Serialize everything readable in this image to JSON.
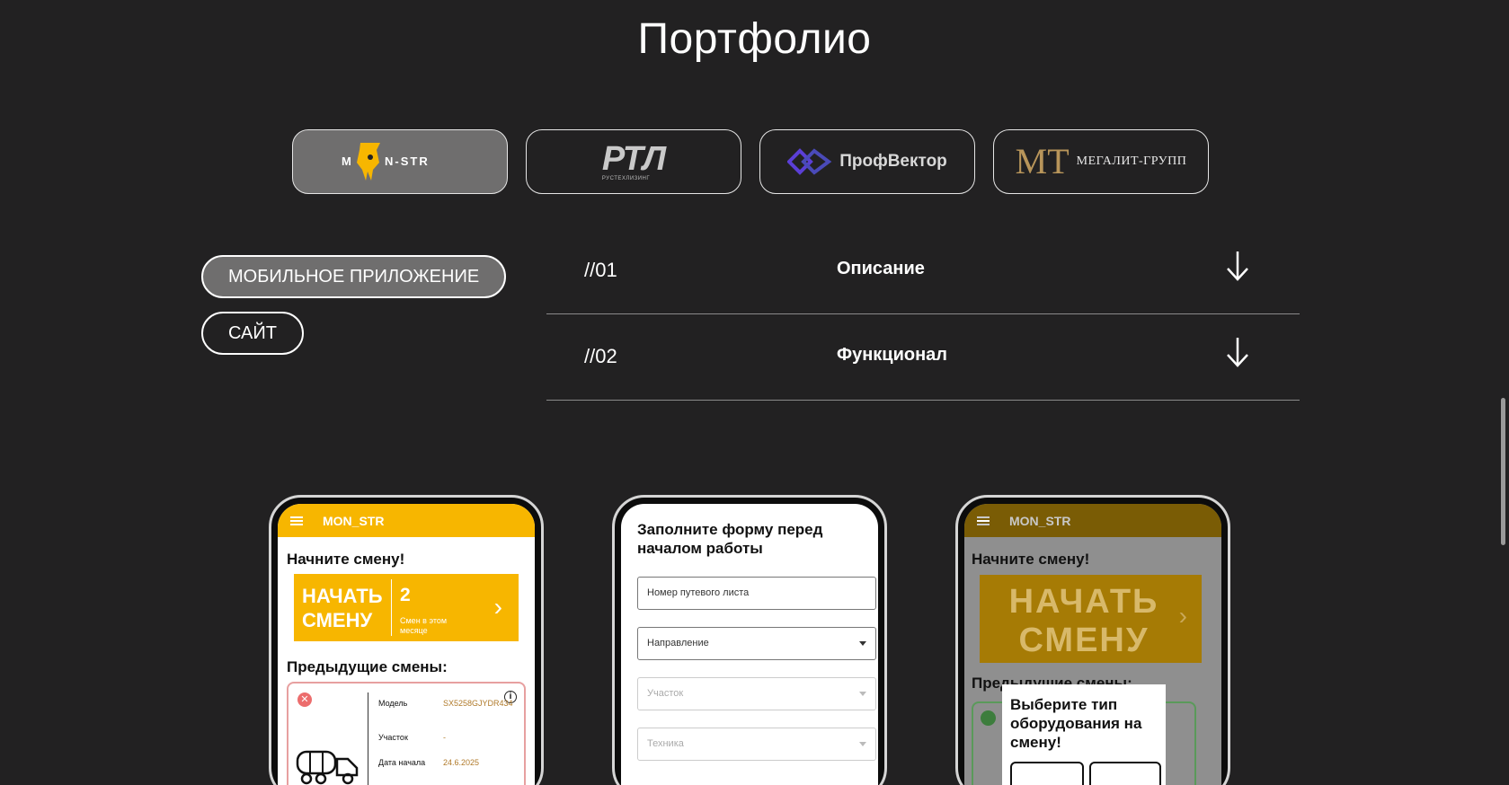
{
  "page": {
    "title": "Портфолио"
  },
  "clients": [
    {
      "name": "MON-STR",
      "active": true
    },
    {
      "name": "РТЛ",
      "sub": "РУСТЕХЛИЗИНГ",
      "active": false
    },
    {
      "name": "ПрофВектор",
      "active": false
    },
    {
      "name": "МЕГАЛИТ-ГРУПП",
      "monogram": "MT",
      "active": false
    }
  ],
  "project_types": [
    {
      "label": "МОБИЛЬНОЕ ПРИЛОЖЕНИЕ",
      "active": true
    },
    {
      "label": "САЙТ",
      "active": false
    }
  ],
  "accordion": [
    {
      "num": "//01",
      "label": "Описание"
    },
    {
      "num": "//02",
      "label": "Функционал"
    }
  ],
  "phone1": {
    "app_title": "MON_STR",
    "start_heading": "Начните смену!",
    "start_button": [
      "НАЧАТЬ",
      "СМЕНУ"
    ],
    "shift_count": "2",
    "shift_count_label": "Смен в этом месяце",
    "prev_heading": "Предыдущие смены:",
    "card": {
      "model_label": "Модель",
      "model_value": "SX5258GJYDR434",
      "area_label": "Участок",
      "area_value": "-",
      "start_label": "Дата начала",
      "start_value": "24.6.2025"
    }
  },
  "phone2": {
    "form_title": "Заполните форму перед началом работы",
    "fields": [
      {
        "placeholder": "Номер путевого листа"
      },
      {
        "placeholder": "Направление"
      },
      {
        "placeholder": "Участок"
      },
      {
        "placeholder": "Техника"
      }
    ]
  },
  "phone3": {
    "app_title": "MON_STR",
    "start_heading": "Начните смену!",
    "start_button": [
      "НАЧАТЬ",
      "СМЕНУ"
    ],
    "prev_heading": "Предыдущие смены:",
    "modal_title": "Выберите тип оборудования на смену!"
  },
  "colors": {
    "accent": "#f7b600",
    "background": "#222122",
    "active_pill": "#6f6e6e"
  }
}
